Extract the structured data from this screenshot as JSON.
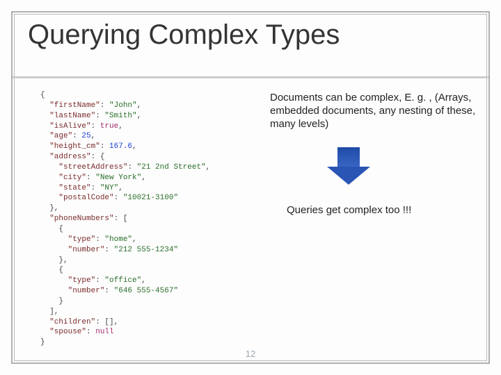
{
  "slide": {
    "title": "Querying Complex Types",
    "note_complex": "Documents can be complex, E. g. , (Arrays, embedded documents, any nesting of these, many levels)",
    "note_queries": "Queries get complex too !!!",
    "page_number": "12",
    "code": {
      "l0": "{",
      "l1_k": "\"firstName\"",
      "l1_c": ": ",
      "l1_v": "\"John\"",
      "l1_e": ",",
      "l2_k": "\"lastName\"",
      "l2_c": ": ",
      "l2_v": "\"Smith\"",
      "l2_e": ",",
      "l3_k": "\"isAlive\"",
      "l3_c": ": ",
      "l3_v": "true",
      "l3_e": ",",
      "l4_k": "\"age\"",
      "l4_c": ": ",
      "l4_v": "25",
      "l4_e": ",",
      "l5_k": "\"height_cm\"",
      "l5_c": ": ",
      "l5_v": "167.6",
      "l5_e": ",",
      "l6_k": "\"address\"",
      "l6_c": ": {",
      "l7_k": "\"streetAddress\"",
      "l7_c": ": ",
      "l7_v": "\"21 2nd Street\"",
      "l7_e": ",",
      "l8_k": "\"city\"",
      "l8_c": ": ",
      "l8_v": "\"New York\"",
      "l8_e": ",",
      "l9_k": "\"state\"",
      "l9_c": ": ",
      "l9_v": "\"NY\"",
      "l9_e": ",",
      "l10_k": "\"postalCode\"",
      "l10_c": ": ",
      "l10_v": "\"10021-3100\"",
      "l11": "},",
      "l12_k": "\"phoneNumbers\"",
      "l12_c": ": [",
      "l13": "{",
      "l14_k": "\"type\"",
      "l14_c": ": ",
      "l14_v": "\"home\"",
      "l14_e": ",",
      "l15_k": "\"number\"",
      "l15_c": ": ",
      "l15_v": "\"212 555-1234\"",
      "l16": "},",
      "l17": "{",
      "l18_k": "\"type\"",
      "l18_c": ": ",
      "l18_v": "\"office\"",
      "l18_e": ",",
      "l19_k": "\"number\"",
      "l19_c": ": ",
      "l19_v": "\"646 555-4567\"",
      "l20": "}",
      "l21": "],",
      "l22_k": "\"children\"",
      "l22_c": ": [],",
      "l23_k": "\"spouse\"",
      "l23_c": ": ",
      "l23_v": "null",
      "l24": "}"
    }
  }
}
